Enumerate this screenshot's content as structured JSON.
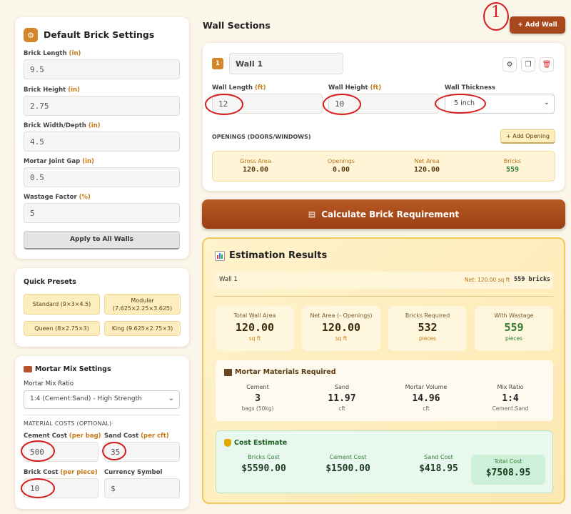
{
  "brick_settings": {
    "title": "Default Brick Settings",
    "fields": [
      {
        "label": "Brick Length",
        "unit": "(in)",
        "value": "9.5"
      },
      {
        "label": "Brick Height",
        "unit": "(in)",
        "value": "2.75"
      },
      {
        "label": "Brick Width/Depth",
        "unit": "(in)",
        "value": "4.5"
      },
      {
        "label": "Mortar Joint Gap",
        "unit": "(in)",
        "value": "0.5"
      },
      {
        "label": "Wastage Factor",
        "unit": "(%)",
        "value": "5"
      }
    ],
    "apply_label": "Apply to All Walls"
  },
  "presets": {
    "title": "Quick Presets",
    "items": [
      {
        "label": "Standard (9×3×4.5)"
      },
      {
        "label": "Modular",
        "sub": "(7.625×2.25×3.625)"
      },
      {
        "label": "Queen (8×2.75×3)"
      },
      {
        "label": "King (9.625×2.75×3)"
      }
    ]
  },
  "mortar": {
    "title": "Mortar Mix Settings",
    "ratio_label": "Mortar Mix Ratio",
    "ratio_value": "1:4 (Cement:Sand) - High Strength",
    "costs_title": "MATERIAL COSTS (OPTIONAL)",
    "cement_label": "Cement Cost",
    "cement_unit": "(per bag)",
    "cement_value": "500",
    "sand_label": "Sand Cost",
    "sand_unit": "(per cft)",
    "sand_value": "35",
    "brick_label": "Brick Cost",
    "brick_unit": "(per piece)",
    "brick_value": "10",
    "currency_label": "Currency Symbol",
    "currency_value": "$"
  },
  "walls": {
    "title": "Wall Sections",
    "add_label": "+ Add Wall",
    "annotation": "1",
    "wall": {
      "index": "1",
      "name": "Wall 1",
      "length_label": "Wall Length",
      "length_unit": "(ft)",
      "length_value": "12",
      "height_label": "Wall Height",
      "height_unit": "(ft)",
      "height_value": "10",
      "thickness_label": "Wall Thickness",
      "thickness_value": "5 inch",
      "openings_title": "OPENINGS (DOORS/WINDOWS)",
      "add_opening_label": "+ Add Opening",
      "summary": [
        {
          "label": "Gross Area",
          "value": "120.00"
        },
        {
          "label": "Openings",
          "value": "0.00"
        },
        {
          "label": "Net Area",
          "value": "120.00"
        },
        {
          "label": "Bricks",
          "value": "559"
        }
      ]
    }
  },
  "calculate_label": "Calculate Brick Requirement",
  "results": {
    "title": "Estimation Results",
    "wall_row": {
      "name": "Wall 1",
      "net": "Net: 120.00 sq ft",
      "bricks": "559 bricks"
    },
    "stats": [
      {
        "label": "Total Wall Area",
        "value": "120.00",
        "unit": "sq ft"
      },
      {
        "label": "Net Area (- Openings)",
        "value": "120.00",
        "unit": "sq ft"
      },
      {
        "label": "Bricks Required",
        "value": "532",
        "unit": "pieces"
      },
      {
        "label": "With Wastage",
        "value": "559",
        "unit": "pieces"
      }
    ],
    "mortar_title": "Mortar Materials Required",
    "mortar_items": [
      {
        "label": "Cement",
        "value": "3",
        "unit": "bags (50kg)"
      },
      {
        "label": "Sand",
        "value": "11.97",
        "unit": "cft"
      },
      {
        "label": "Mortar Volume",
        "value": "14.96",
        "unit": "cft"
      },
      {
        "label": "Mix Ratio",
        "value": "1:4",
        "unit": "Cement:Sand"
      }
    ],
    "cost_title": "Cost Estimate",
    "cost_items": [
      {
        "label": "Bricks Cost",
        "value": "$5590.00"
      },
      {
        "label": "Cement Cost",
        "value": "$1500.00"
      },
      {
        "label": "Sand Cost",
        "value": "$418.95"
      }
    ],
    "total_label": "Total Cost",
    "total_value": "$7508.95"
  }
}
